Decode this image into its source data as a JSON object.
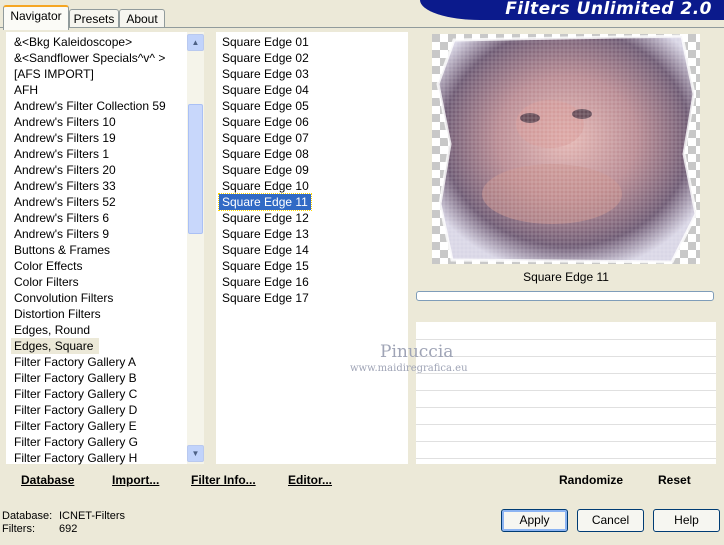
{
  "window": {
    "title": "Filters Unlimited 2.0"
  },
  "tabs": [
    "Navigator",
    "Presets",
    "About"
  ],
  "categories": {
    "items": [
      "&<Bkg Kaleidoscope>",
      "&<Sandflower Specials^v^ >",
      "[AFS IMPORT]",
      "AFH",
      "Andrew's Filter Collection 59",
      "Andrew's Filters 10",
      "Andrew's Filters 19",
      "Andrew's Filters 1",
      "Andrew's Filters 20",
      "Andrew's Filters 33",
      "Andrew's Filters 52",
      "Andrew's Filters 6",
      "Andrew's Filters 9",
      "Buttons & Frames",
      "Color Effects",
      "Color Filters",
      "Convolution Filters",
      "Distortion Filters",
      "Edges, Round",
      "Edges, Square",
      "Filter Factory Gallery A",
      "Filter Factory Gallery B",
      "Filter Factory Gallery C",
      "Filter Factory Gallery D",
      "Filter Factory Gallery E",
      "Filter Factory Gallery G",
      "Filter Factory Gallery H"
    ],
    "selected": "Edges, Square",
    "scroll_up_icon": "arrow-up-icon",
    "scroll_down_icon": "arrow-down-icon"
  },
  "filters": {
    "items": [
      "Square Edge 01",
      "Square Edge 02",
      "Square Edge 03",
      "Square Edge 04",
      "Square Edge 05",
      "Square Edge 06",
      "Square Edge 07",
      "Square Edge 08",
      "Square Edge 09",
      "Square Edge 10",
      "Square Edge 11",
      "Square Edge 12",
      "Square Edge 13",
      "Square Edge 14",
      "Square Edge 15",
      "Square Edge 16",
      "Square Edge 17"
    ],
    "selected": "Square Edge 11"
  },
  "preview": {
    "label": "Square Edge 11",
    "progress": 0
  },
  "watermark": {
    "name": "Pinuccia",
    "url": "www.maidiregrafica.eu"
  },
  "toolbar_left": {
    "database": "Database",
    "import": "Import...",
    "filter_info": "Filter Info...",
    "editor": "Editor..."
  },
  "toolbar_right": {
    "randomize": "Randomize",
    "reset": "Reset"
  },
  "status": {
    "database_label": "Database:",
    "database_value": "ICNET-Filters",
    "filters_label": "Filters:",
    "filters_value": "692"
  },
  "buttons": {
    "apply": "Apply",
    "cancel": "Cancel",
    "help": "Help"
  },
  "colors": {
    "banner": "#0b1a8c",
    "selection": "#316ac5",
    "face": "#ece9d8"
  }
}
